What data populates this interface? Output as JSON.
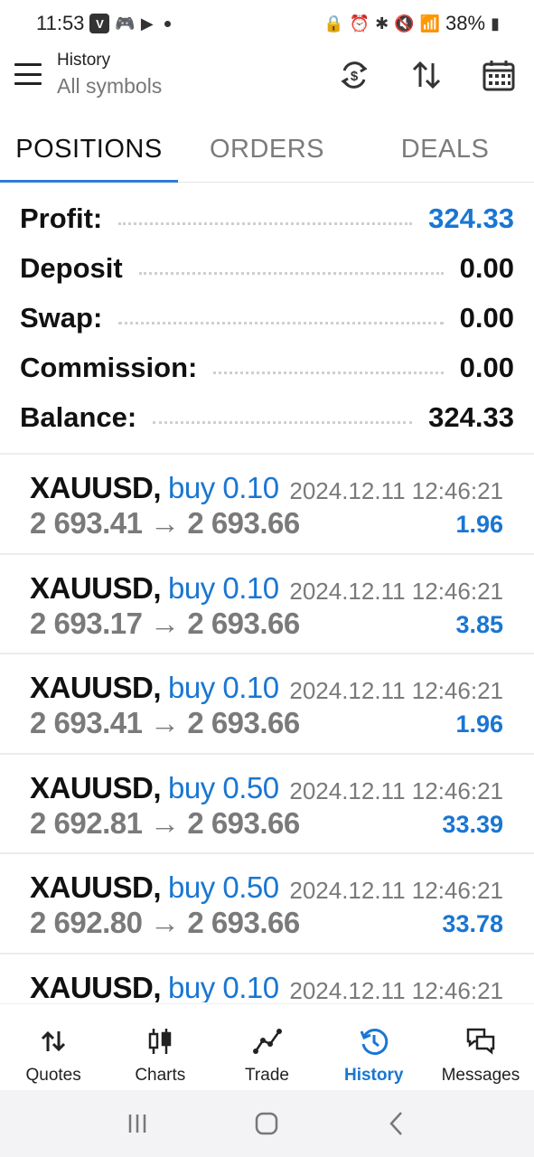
{
  "status_bar": {
    "time": "11:53",
    "app_icon_letter": "V",
    "battery": "38%"
  },
  "header": {
    "title": "History",
    "subtitle": "All symbols",
    "icons": [
      "sync-dollar-icon",
      "sort-icon",
      "calendar-icon"
    ]
  },
  "tabs": [
    {
      "label": "POSITIONS",
      "active": true
    },
    {
      "label": "ORDERS",
      "active": false
    },
    {
      "label": "DEALS",
      "active": false
    }
  ],
  "summary": [
    {
      "label": "Profit:",
      "value": "324.33",
      "highlight": true
    },
    {
      "label": "Deposit",
      "value": "0.00",
      "highlight": false
    },
    {
      "label": "Swap:",
      "value": "0.00",
      "highlight": false
    },
    {
      "label": "Commission:",
      "value": "0.00",
      "highlight": false
    },
    {
      "label": "Balance:",
      "value": "324.33",
      "highlight": false
    }
  ],
  "deals": [
    {
      "symbol": "XAUUSD,",
      "side": "buy 0.10",
      "time": "2024.12.11 12:46:21",
      "open": "2 693.41",
      "arrow": "→",
      "close": "2 693.66",
      "profit": "1.96"
    },
    {
      "symbol": "XAUUSD,",
      "side": "buy 0.10",
      "time": "2024.12.11 12:46:21",
      "open": "2 693.17",
      "arrow": "→",
      "close": "2 693.66",
      "profit": "3.85"
    },
    {
      "symbol": "XAUUSD,",
      "side": "buy 0.10",
      "time": "2024.12.11 12:46:21",
      "open": "2 693.41",
      "arrow": "→",
      "close": "2 693.66",
      "profit": "1.96"
    },
    {
      "symbol": "XAUUSD,",
      "side": "buy 0.50",
      "time": "2024.12.11 12:46:21",
      "open": "2 692.81",
      "arrow": "→",
      "close": "2 693.66",
      "profit": "33.39"
    },
    {
      "symbol": "XAUUSD,",
      "side": "buy 0.50",
      "time": "2024.12.11 12:46:21",
      "open": "2 692.80",
      "arrow": "→",
      "close": "2 693.66",
      "profit": "33.78"
    },
    {
      "symbol": "XAUUSD,",
      "side": "buy 0.10",
      "time": "2024.12.11 12:46:21",
      "open": "",
      "arrow": "",
      "close": "",
      "profit": ""
    }
  ],
  "bottom_nav": [
    {
      "label": "Quotes",
      "icon": "quotes-arrows-icon",
      "active": false
    },
    {
      "label": "Charts",
      "icon": "candlestick-icon",
      "active": false
    },
    {
      "label": "Trade",
      "icon": "trend-line-icon",
      "active": false
    },
    {
      "label": "History",
      "icon": "history-clock-icon",
      "active": true
    },
    {
      "label": "Messages",
      "icon": "chat-bubbles-icon",
      "active": false
    }
  ],
  "colors": {
    "accent": "#1976d2",
    "tab_underline": "#2f7bd8",
    "muted": "#7a7a7a"
  }
}
